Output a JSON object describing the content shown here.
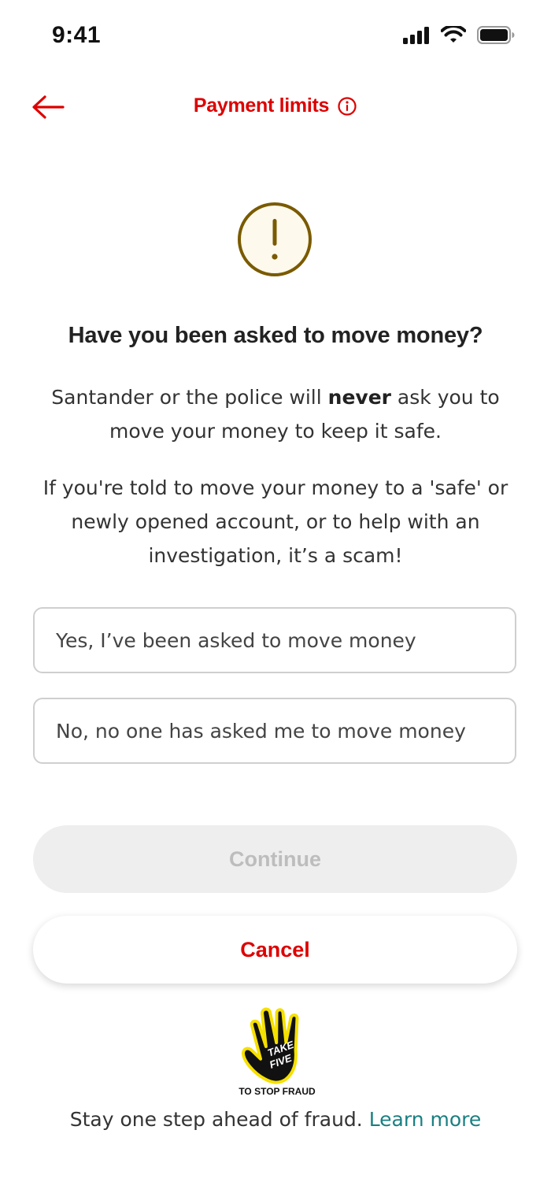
{
  "status_bar": {
    "time": "9:41",
    "icons": [
      "signal-icon",
      "wifi-icon",
      "battery-icon"
    ]
  },
  "header": {
    "title": "Payment limits",
    "back_icon": "arrow-left-icon",
    "info_icon": "info-icon"
  },
  "warning_icon": "exclamation-circle-icon",
  "main": {
    "title": "Have you been asked to move money?",
    "para1_before": "Santander or the police will ",
    "para1_bold": "never",
    "para1_after": " ask you to move your money to keep it safe.",
    "para2": "If you're told to move your money to a 'safe' or newly opened account, or to help with an investigation, it’s a scam!"
  },
  "options": {
    "yes": "Yes, I’ve been asked to move money",
    "no": "No, no one has asked me to move money"
  },
  "buttons": {
    "continue": "Continue",
    "cancel": "Cancel"
  },
  "logo": {
    "line1": "TAKE",
    "line2": "FIVE",
    "caption": "TO STOP FRAUD"
  },
  "footer": {
    "text": "Stay one step ahead of fraud.",
    "link": "Learn more"
  },
  "colors": {
    "brand_red": "#dd0000",
    "warning_gold": "#7a5a00",
    "warning_fill": "#fdf9ec",
    "link_teal": "#1a7f82",
    "disabled_bg": "#eeeeee",
    "disabled_text": "#bdbdbd"
  }
}
